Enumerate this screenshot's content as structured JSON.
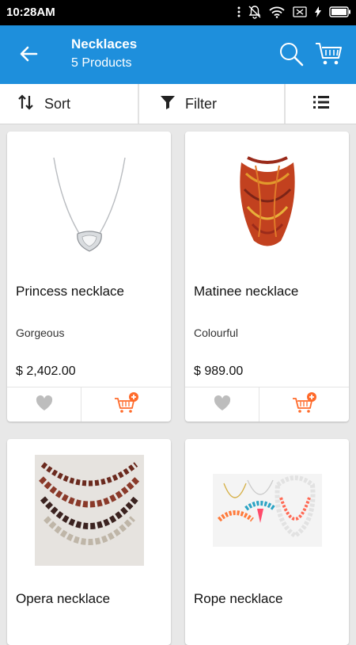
{
  "status_bar": {
    "time": "10:28AM"
  },
  "header": {
    "title": "Necklaces",
    "subtitle": "5 Products"
  },
  "toolbar": {
    "sort_label": "Sort",
    "filter_label": "Filter"
  },
  "products": [
    {
      "name": "Princess necklace",
      "description": "Gorgeous",
      "price": "$ 2,402.00"
    },
    {
      "name": "Matinee necklace",
      "description": "Colourful",
      "price": "$ 989.00"
    },
    {
      "name": "Opera necklace",
      "description": "",
      "price": ""
    },
    {
      "name": "Rope necklace",
      "description": "",
      "price": ""
    }
  ],
  "colors": {
    "appbar": "#1e8fdc",
    "add_to_cart": "#ff6a2a",
    "favorite": "#bdbdbd"
  }
}
